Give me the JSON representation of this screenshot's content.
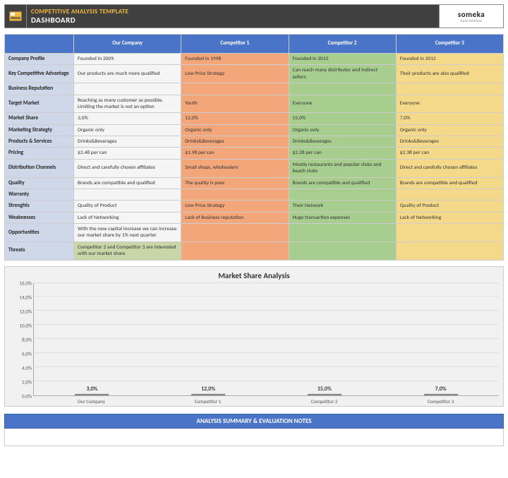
{
  "header": {
    "title": "COMPETITIVE ANALYSIS TEMPLATE",
    "subtitle": "DASHBOARD",
    "logo_main": "someka",
    "logo_sub": "Excel Solutions"
  },
  "columns": [
    "",
    "Our Company",
    "Competitor 1",
    "Competitor 2",
    "Competitor 3"
  ],
  "rows": [
    {
      "label": "Company Profile",
      "our": "Founded in 2009.",
      "c1": "Founded in 1998",
      "c2": "Founded in 2015",
      "c3": "Founded in 2012"
    },
    {
      "label": "Key Competitive Advantage",
      "our": "Our products are much more qualified",
      "c1": "Low Price Strategy",
      "c2": "Can reach many distributor and indirect sellers",
      "c3": "Their products are also qualified"
    },
    {
      "label": "Business Reputation",
      "our": "",
      "c1": "",
      "c2": "",
      "c3": ""
    },
    {
      "label": "Target Market",
      "our": "Reaching as many customer as possible. Limiting the market is not an option",
      "c1": "Youth",
      "c2": "Everyone",
      "c3": "Everyone"
    },
    {
      "label": "Market Share",
      "our": "3,0%",
      "c1": "12,0%",
      "c2": "15,0%",
      "c3": "7,0%"
    },
    {
      "label": "Marketing Strategty",
      "our": "Organic only",
      "c1": "Organic only",
      "c2": "Organic only",
      "c3": "Organic only"
    },
    {
      "label": "Products & Services",
      "our": "Drinks&Beverages",
      "c1": "Drinks&Beverages",
      "c2": "Drinks&Beverages",
      "c3": "Drinks&Beverages"
    },
    {
      "label": "Pricing",
      "our": "$2.48 per can",
      "c1": "$1.98 per can",
      "c2": "$2.28 per can",
      "c3": "$2.38 per can"
    },
    {
      "label": "Distribution Channels",
      "our": "Direct and carefully chosen affiliates",
      "c1": "Small shops, wholesalers",
      "c2": "Mostly restaurants and popular clubs and beach clubs",
      "c3": "Direct and carefully chosen affiliates"
    },
    {
      "label": "Quality",
      "our": "Brands are compatible and qualified",
      "c1": "The quality is poor",
      "c2": "Brands are compatible and qualified",
      "c3": "Brands are compatible and qualified"
    },
    {
      "label": "Warranty",
      "our": "",
      "c1": "",
      "c2": "",
      "c3": ""
    },
    {
      "label": "Strenghts",
      "our": "Quality of Product",
      "c1": "Low Price Strategy",
      "c2": "Their Network",
      "c3": "Quality of Product"
    },
    {
      "label": "Weaknesses",
      "our": "Lack of Networking",
      "c1": "Lack of  Business reputation",
      "c2": "Huge transaction expenses",
      "c3": "Lack of Networking"
    },
    {
      "label": "Opportunities",
      "our": "With the new capital increase we can increase our market share by 1% next quarter",
      "c1": "",
      "c2": "",
      "c3": ""
    },
    {
      "label": "Threats",
      "our": "Competitor 2 and Competitor 3 are interested with our market share",
      "our_hl": true,
      "c1": "",
      "c2": "",
      "c3": ""
    }
  ],
  "chart_data": {
    "type": "bar",
    "title": "Market Share Analysis",
    "categories": [
      "Our Company",
      "Competitor 1",
      "Competitor 2",
      "Competitor 3"
    ],
    "values": [
      3.0,
      12.0,
      15.0,
      7.0
    ],
    "value_labels": [
      "3,0%",
      "12,0%",
      "15,0%",
      "7,0%"
    ],
    "ylim": [
      0,
      16
    ],
    "yticks": [
      "0,0%",
      "2,0%",
      "4,0%",
      "6,0%",
      "8,0%",
      "10,0%",
      "12,0%",
      "14,0%",
      "16,0%"
    ],
    "xlabel": "",
    "ylabel": ""
  },
  "notes": {
    "header": "ANALYSIS SUMMARY & EVALUATION NOTES"
  }
}
